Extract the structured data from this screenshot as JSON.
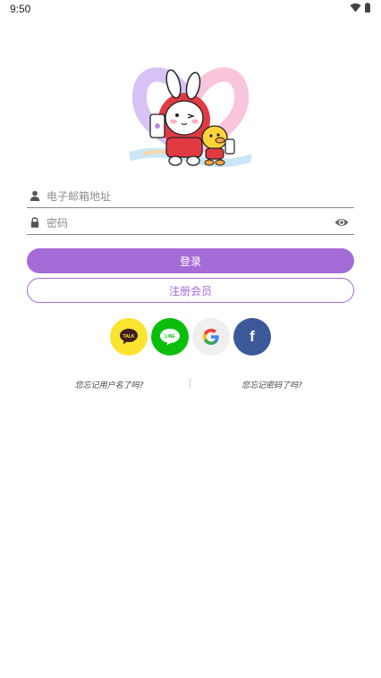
{
  "status": {
    "time": "9:50",
    "wifi_icon": "wifi-icon",
    "battery_icon": "battery-icon"
  },
  "logo": {
    "icon": "rabbit-duck-heart-logo"
  },
  "login_form": {
    "email_placeholder": "电子邮箱地址",
    "password_placeholder": "密码",
    "login_label": "登录",
    "register_label": "注册会员"
  },
  "social": {
    "kakao_text": "TALK",
    "line_text": "LINE",
    "google_text": "G",
    "facebook_text": "f"
  },
  "links": {
    "forgot_username": "您忘记用户名了吗?",
    "forgot_password": "您忘记密码了吗?"
  },
  "colors": {
    "accent": "#a56bd6",
    "kakao": "#fae42f",
    "line": "#0abf0a",
    "google_bg": "#efefef",
    "facebook": "#3b5999"
  }
}
